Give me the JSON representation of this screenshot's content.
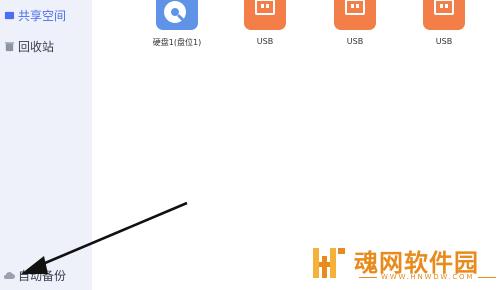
{
  "sidebar": {
    "items": [
      {
        "label": "共享空间",
        "icon": "share-space-icon",
        "active": true
      },
      {
        "label": "回收站",
        "icon": "trash-icon",
        "active": false
      },
      {
        "label": "自动备份",
        "icon": "cloud-icon",
        "active": false
      }
    ]
  },
  "devices": [
    {
      "label": "硬盘1(盘位1)",
      "icon": "hard-disk-icon"
    },
    {
      "label": "USB",
      "icon": "usb-drive-icon"
    },
    {
      "label": "USB",
      "icon": "usb-drive-icon"
    },
    {
      "label": "USB",
      "icon": "usb-drive-icon"
    }
  ],
  "colors": {
    "accent": "#4a6ff0",
    "disk": "#5f93e8",
    "usb": "#f47e47",
    "watermark": "#e88b1c"
  },
  "watermark": {
    "title": "魂网软件园",
    "url": "WWW.HNWDW.COM"
  }
}
